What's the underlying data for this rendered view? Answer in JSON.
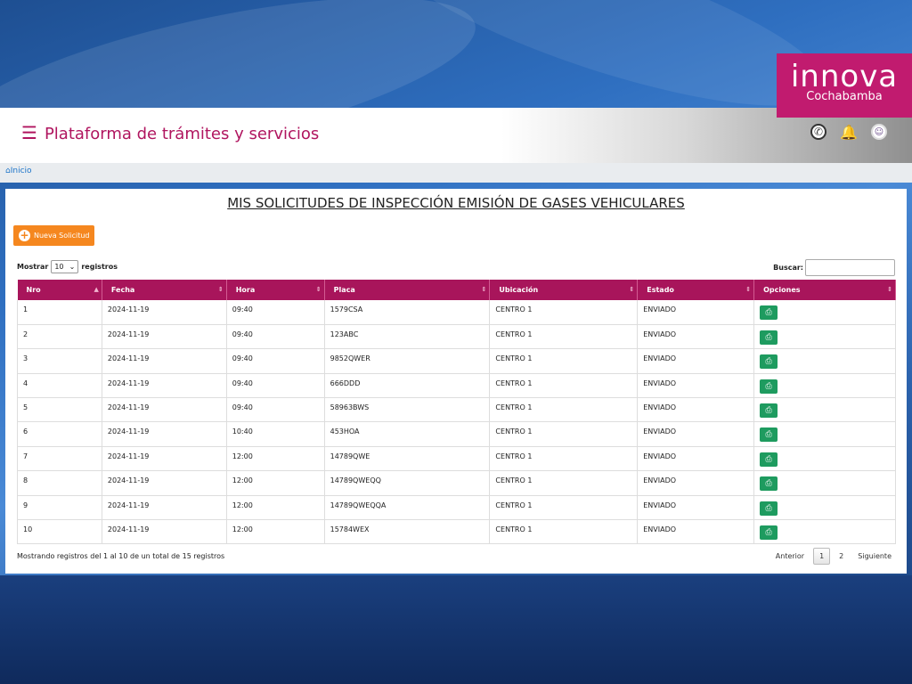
{
  "brand": {
    "logo_big": "innova",
    "logo_small": "Cochabamba",
    "color": "#c11b6f"
  },
  "header": {
    "title": "Plataforma de trámites y servicios",
    "menu_icon": "hamburger-icon",
    "icons": [
      "whatsapp-icon",
      "bell-icon",
      "avatar-icon"
    ]
  },
  "breadcrumb": {
    "label": "Inicio",
    "icon": "home-icon"
  },
  "page": {
    "title": "MIS SOLICITUDES DE INSPECCIÓN EMISIÓN DE GASES VEHICULARES",
    "new_button": "Nueva Solicitud"
  },
  "table_controls": {
    "show_label": "Mostrar",
    "page_size": "10",
    "records_label": "registros",
    "search_label": "Buscar:"
  },
  "table": {
    "columns": [
      "Nro",
      "Fecha",
      "Hora",
      "Placa",
      "Ubicación",
      "Estado",
      "Opciones"
    ],
    "rows": [
      {
        "nro": "1",
        "fecha": "2024-11-19",
        "hora": "09:40",
        "placa": "1579CSA",
        "ubicacion": "CENTRO 1",
        "estado": "ENVIADO"
      },
      {
        "nro": "2",
        "fecha": "2024-11-19",
        "hora": "09:40",
        "placa": "123ABC",
        "ubicacion": "CENTRO 1",
        "estado": "ENVIADO"
      },
      {
        "nro": "3",
        "fecha": "2024-11-19",
        "hora": "09:40",
        "placa": "9852QWER",
        "ubicacion": "CENTRO 1",
        "estado": "ENVIADO"
      },
      {
        "nro": "4",
        "fecha": "2024-11-19",
        "hora": "09:40",
        "placa": "666DDD",
        "ubicacion": "CENTRO 1",
        "estado": "ENVIADO"
      },
      {
        "nro": "5",
        "fecha": "2024-11-19",
        "hora": "09:40",
        "placa": "58963BWS",
        "ubicacion": "CENTRO 1",
        "estado": "ENVIADO"
      },
      {
        "nro": "6",
        "fecha": "2024-11-19",
        "hora": "10:40",
        "placa": "453HOA",
        "ubicacion": "CENTRO 1",
        "estado": "ENVIADO"
      },
      {
        "nro": "7",
        "fecha": "2024-11-19",
        "hora": "12:00",
        "placa": "14789QWE",
        "ubicacion": "CENTRO 1",
        "estado": "ENVIADO"
      },
      {
        "nro": "8",
        "fecha": "2024-11-19",
        "hora": "12:00",
        "placa": "14789QWEQQ",
        "ubicacion": "CENTRO 1",
        "estado": "ENVIADO"
      },
      {
        "nro": "9",
        "fecha": "2024-11-19",
        "hora": "12:00",
        "placa": "14789QWEQQA",
        "ubicacion": "CENTRO 1",
        "estado": "ENVIADO"
      },
      {
        "nro": "10",
        "fecha": "2024-11-19",
        "hora": "12:00",
        "placa": "15784WEX",
        "ubicacion": "CENTRO 1",
        "estado": "ENVIADO"
      }
    ]
  },
  "footer": {
    "info": "Mostrando registros del 1 al 10 de un total de 15 registros",
    "prev": "Anterior",
    "pages": [
      "1",
      "2"
    ],
    "next": "Siguiente"
  },
  "colors": {
    "accent": "#a8155b",
    "print_button": "#1e9b5f",
    "new_button": "#f5871f"
  }
}
